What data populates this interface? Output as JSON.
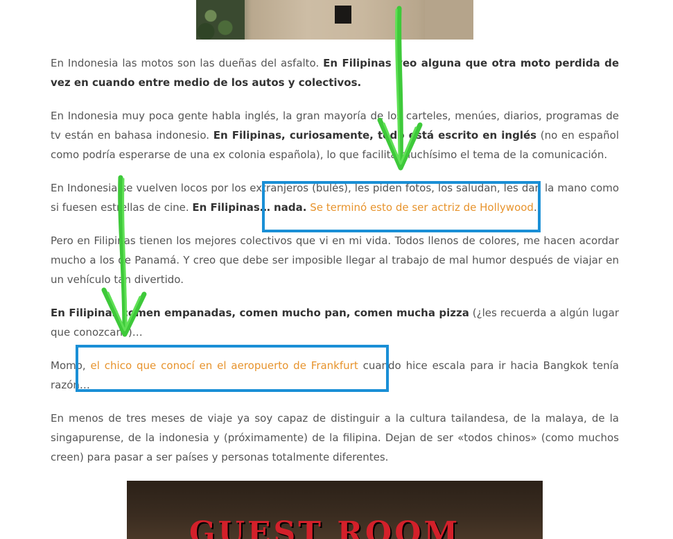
{
  "paragraphs": {
    "p1": {
      "text1": "En Indonesia las motos son las dueñas del asfalto. ",
      "bold1": "En Filipinas veo alguna que otra moto perdida de vez en cuando entre medio de los autos y colectivos."
    },
    "p2": {
      "text1": "En Indonesia muy poca gente habla inglés, la gran mayoría de los carteles, menúes, diarios, programas de tv están en bahasa indonesio. ",
      "bold1": "En Filipinas, curiosamente, todo está escrito en inglés",
      "text2": " (no en español como podría esperarse de una ex colonia española), lo que facilita muchísimo el tema de la comunicación."
    },
    "p3": {
      "text1": "En Indonesia se vuelven locos por los extranjeros (bulés), les piden fotos, los saludan, les dan la mano como si fuesen estrellas de cine. ",
      "bold1": "En Filipinas… nada.",
      "link1": "Se terminó esto de ser actriz de Hollywood",
      "text2": "."
    },
    "p4": {
      "text1": "Pero en Filipinas tienen los mejores colectivos que vi en mi vida. Todos llenos de colores, me hacen acordar mucho a los de Panamá. Y creo que debe ser imposible llegar al trabajo de mal humor después de viajar en un vehículo tan divertido."
    },
    "p5": {
      "bold1": "En Filipinas comen empanadas, comen mucho pan, comen mucha pizza",
      "text1": " (¿les recuerda a algún lugar que conozcan?)…"
    },
    "p6": {
      "text1": "Momo, ",
      "link1": "el chico que conocí en el aeropuerto de Frankfurt",
      "text2": " cuando hice escala para ir hacia Bangkok tenía razón…"
    },
    "p7": {
      "text1": "En menos de tres meses de viaje ya soy capaz de distinguir a la cultura tailandesa, de la malaya, de la singapurense, de la indonesia y (próximamente) de la filipina. Dejan de ser «todos chinos» (como muchos creen) para pasar a ser países y personas totalmente diferentes."
    }
  },
  "images": {
    "bottom_sign_text": "GUEST ROOM"
  },
  "annotations": {
    "box_color": "#1a8fd6",
    "arrow_color": "#3ec93a"
  },
  "colors": {
    "link": "#e7932c",
    "text": "#555555",
    "bold_text": "#333333"
  }
}
